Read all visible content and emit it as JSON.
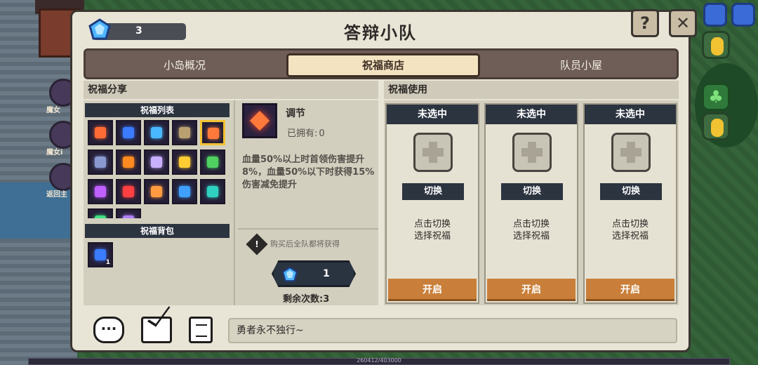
{
  "title": "答辩小队",
  "currency": {
    "value": "3"
  },
  "help_label": "?",
  "close_label": "✕",
  "tabs": [
    {
      "label": "小岛概况"
    },
    {
      "label": "祝福商店"
    },
    {
      "label": "队员小屋"
    }
  ],
  "active_tab": "祝福商店",
  "share": {
    "heading": "祝福分享",
    "list_heading": "祝福列表",
    "bag_heading": "祝福背包",
    "bag_count": "1",
    "blessing_colors": [
      "#ff6b35",
      "#3a7bff",
      "#4ab8ff",
      "#b8a070",
      "#ff7a3a",
      "#8a9ad0",
      "#ff8a20",
      "#c8b0ff",
      "#ffcc33",
      "#50d060",
      "#c060ff",
      "#ff4040",
      "#ff9a40",
      "#40a0ff",
      "#30d0c0",
      "#40e080",
      "#b080ff"
    ]
  },
  "detail": {
    "name": "调节",
    "owned_label": "已拥有:",
    "owned_value": "0",
    "description": "血量50%以上时首领伤害提升8%，血量50%以下时获得15%伤害减免提升",
    "notice_icon_text": "!",
    "notice": "购买后全队都将获得",
    "price": "1",
    "remaining_label": "剩余次数:",
    "remaining_value": "3"
  },
  "use": {
    "heading": "祝福使用",
    "slots": [
      {
        "status": "未选中",
        "switch_label": "切换",
        "hint_line1": "点击切换",
        "hint_line2": "选择祝福",
        "open_label": "开启"
      },
      {
        "status": "未选中",
        "switch_label": "切换",
        "hint_line1": "点击切换",
        "hint_line2": "选择祝福",
        "open_label": "开启"
      },
      {
        "status": "未选中",
        "switch_label": "切换",
        "hint_line1": "点击切换",
        "hint_line2": "选择祝福",
        "open_label": "开启"
      }
    ]
  },
  "footer": {
    "message": "勇者永不独行~"
  },
  "background": {
    "side_labels": [
      "魔女",
      "魔女i",
      "返回主"
    ],
    "progress_text": "260412/403000"
  },
  "colors": {
    "accent_orange": "#c97f39",
    "dark_panel": "#2c3440",
    "tab_active": "#f4e3c1"
  }
}
